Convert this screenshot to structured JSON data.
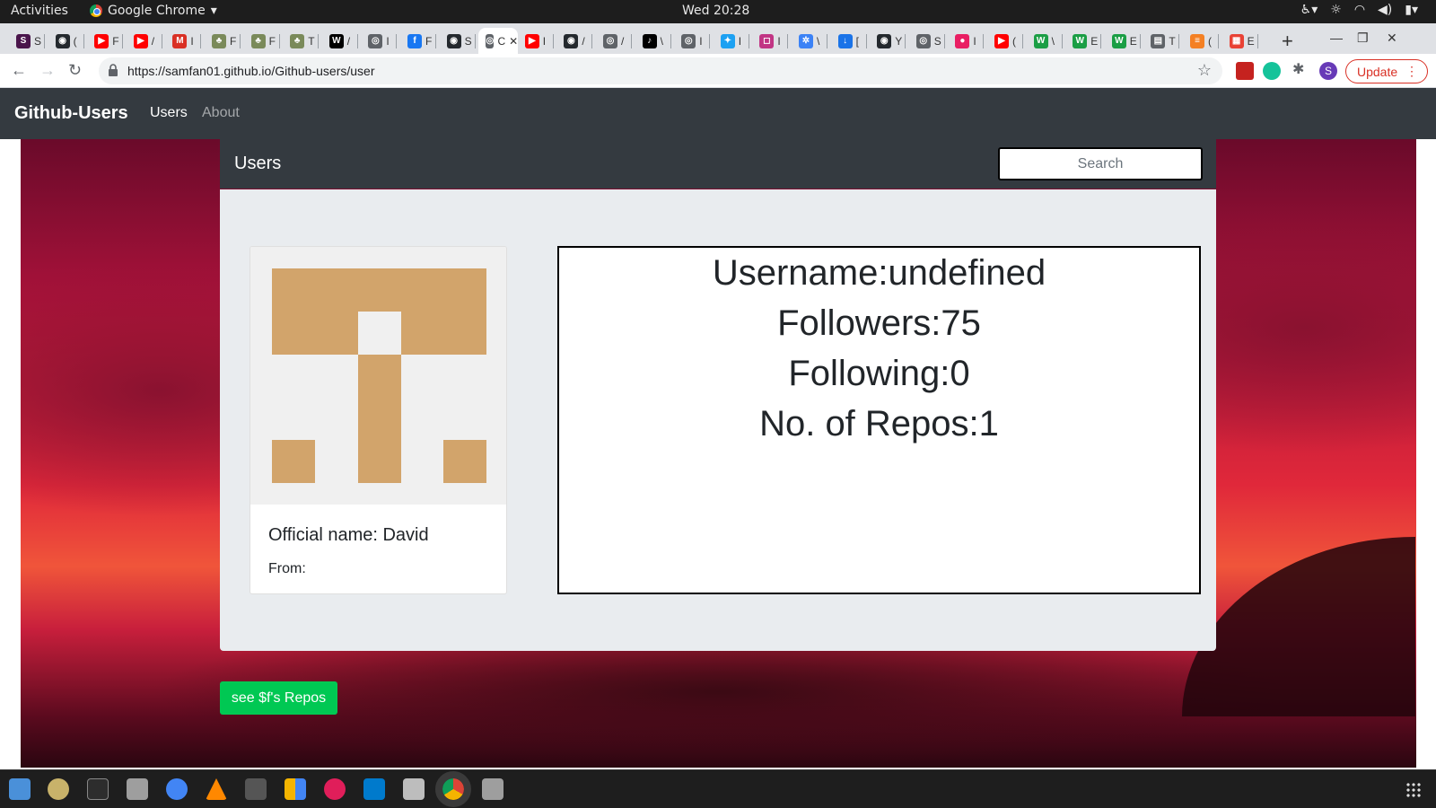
{
  "os": {
    "activities": "Activities",
    "app_name": "Google Chrome",
    "clock": "Wed 20:28"
  },
  "browser": {
    "tabs": [
      {
        "fav": "slack-icon",
        "color": "#4a154b",
        "glyph": "S",
        "label": "S"
      },
      {
        "fav": "github-icon",
        "color": "#24292e",
        "glyph": "◉",
        "label": "("
      },
      {
        "fav": "youtube-icon",
        "color": "#ff0000",
        "glyph": "▶",
        "label": "F"
      },
      {
        "fav": "youtube-icon",
        "color": "#ff0000",
        "glyph": "▶",
        "label": "/"
      },
      {
        "fav": "gmail-icon",
        "color": "#d93025",
        "glyph": "M",
        "label": "I"
      },
      {
        "fav": "palm-icon",
        "color": "#7a8a5a",
        "glyph": "♣",
        "label": "F"
      },
      {
        "fav": "palm-icon",
        "color": "#7a8a5a",
        "glyph": "♣",
        "label": "F"
      },
      {
        "fav": "palm-icon",
        "color": "#7a8a5a",
        "glyph": "♣",
        "label": "T"
      },
      {
        "fav": "wix-icon",
        "color": "#000000",
        "glyph": "W",
        "label": "/"
      },
      {
        "fav": "globe-icon",
        "color": "#5f6368",
        "glyph": "◎",
        "label": "I"
      },
      {
        "fav": "facebook-icon",
        "color": "#1877f2",
        "glyph": "f",
        "label": "F"
      },
      {
        "fav": "github-icon",
        "color": "#24292e",
        "glyph": "◉",
        "label": "S"
      },
      {
        "fav": "globe-icon",
        "color": "#5f6368",
        "glyph": "◎",
        "label": "C"
      },
      {
        "fav": "youtube-icon",
        "color": "#ff0000",
        "glyph": "▶",
        "label": "I"
      },
      {
        "fav": "github-icon",
        "color": "#24292e",
        "glyph": "◉",
        "label": "/"
      },
      {
        "fav": "globe-icon",
        "color": "#5f6368",
        "glyph": "◎",
        "label": "/"
      },
      {
        "fav": "tiktok-icon",
        "color": "#000000",
        "glyph": "♪",
        "label": "\\"
      },
      {
        "fav": "globe-icon",
        "color": "#5f6368",
        "glyph": "◎",
        "label": "I"
      },
      {
        "fav": "twitter-icon",
        "color": "#1da1f2",
        "glyph": "✦",
        "label": "I"
      },
      {
        "fav": "instagram-icon",
        "color": "#c13584",
        "glyph": "◻",
        "label": "I"
      },
      {
        "fav": "network-icon",
        "color": "#3b82f6",
        "glyph": "✲",
        "label": "\\"
      },
      {
        "fav": "download-icon",
        "color": "#1a73e8",
        "glyph": "↓",
        "label": "["
      },
      {
        "fav": "github-icon",
        "color": "#24292e",
        "glyph": "◉",
        "label": "Y"
      },
      {
        "fav": "globe-icon",
        "color": "#5f6368",
        "glyph": "◎",
        "label": "S"
      },
      {
        "fav": "pink-circle-icon",
        "color": "#e91e63",
        "glyph": "●",
        "label": "I"
      },
      {
        "fav": "youtube-icon",
        "color": "#ff0000",
        "glyph": "▶",
        "label": "("
      },
      {
        "fav": "wattpad-icon",
        "color": "#1b9e45",
        "glyph": "W",
        "label": "\\"
      },
      {
        "fav": "wattpad-icon",
        "color": "#1b9e45",
        "glyph": "W",
        "label": "E"
      },
      {
        "fav": "wattpad-icon",
        "color": "#1b9e45",
        "glyph": "W",
        "label": "E"
      },
      {
        "fav": "book-icon",
        "color": "#5f6368",
        "glyph": "▤",
        "label": "T"
      },
      {
        "fav": "stack-icon",
        "color": "#f48024",
        "glyph": "≡",
        "label": "("
      },
      {
        "fav": "blocks-icon",
        "color": "#e94235",
        "glyph": "▦",
        "label": "E"
      }
    ],
    "url": "https://samfan01.github.io/Github-users/user",
    "update_label": "Update"
  },
  "site": {
    "brand": "Github-Users",
    "nav": {
      "users": "Users",
      "about": "About"
    },
    "header_title": "Users",
    "search_placeholder": "Search",
    "profile": {
      "official_name": "Official name: David",
      "from": "From:"
    },
    "info": {
      "username": "Username:undefined",
      "followers": "Followers:75",
      "following": "Following:0",
      "repos": "No. of Repos:1"
    },
    "repos_button": "see $f's Repos",
    "accent": "#00c853"
  }
}
